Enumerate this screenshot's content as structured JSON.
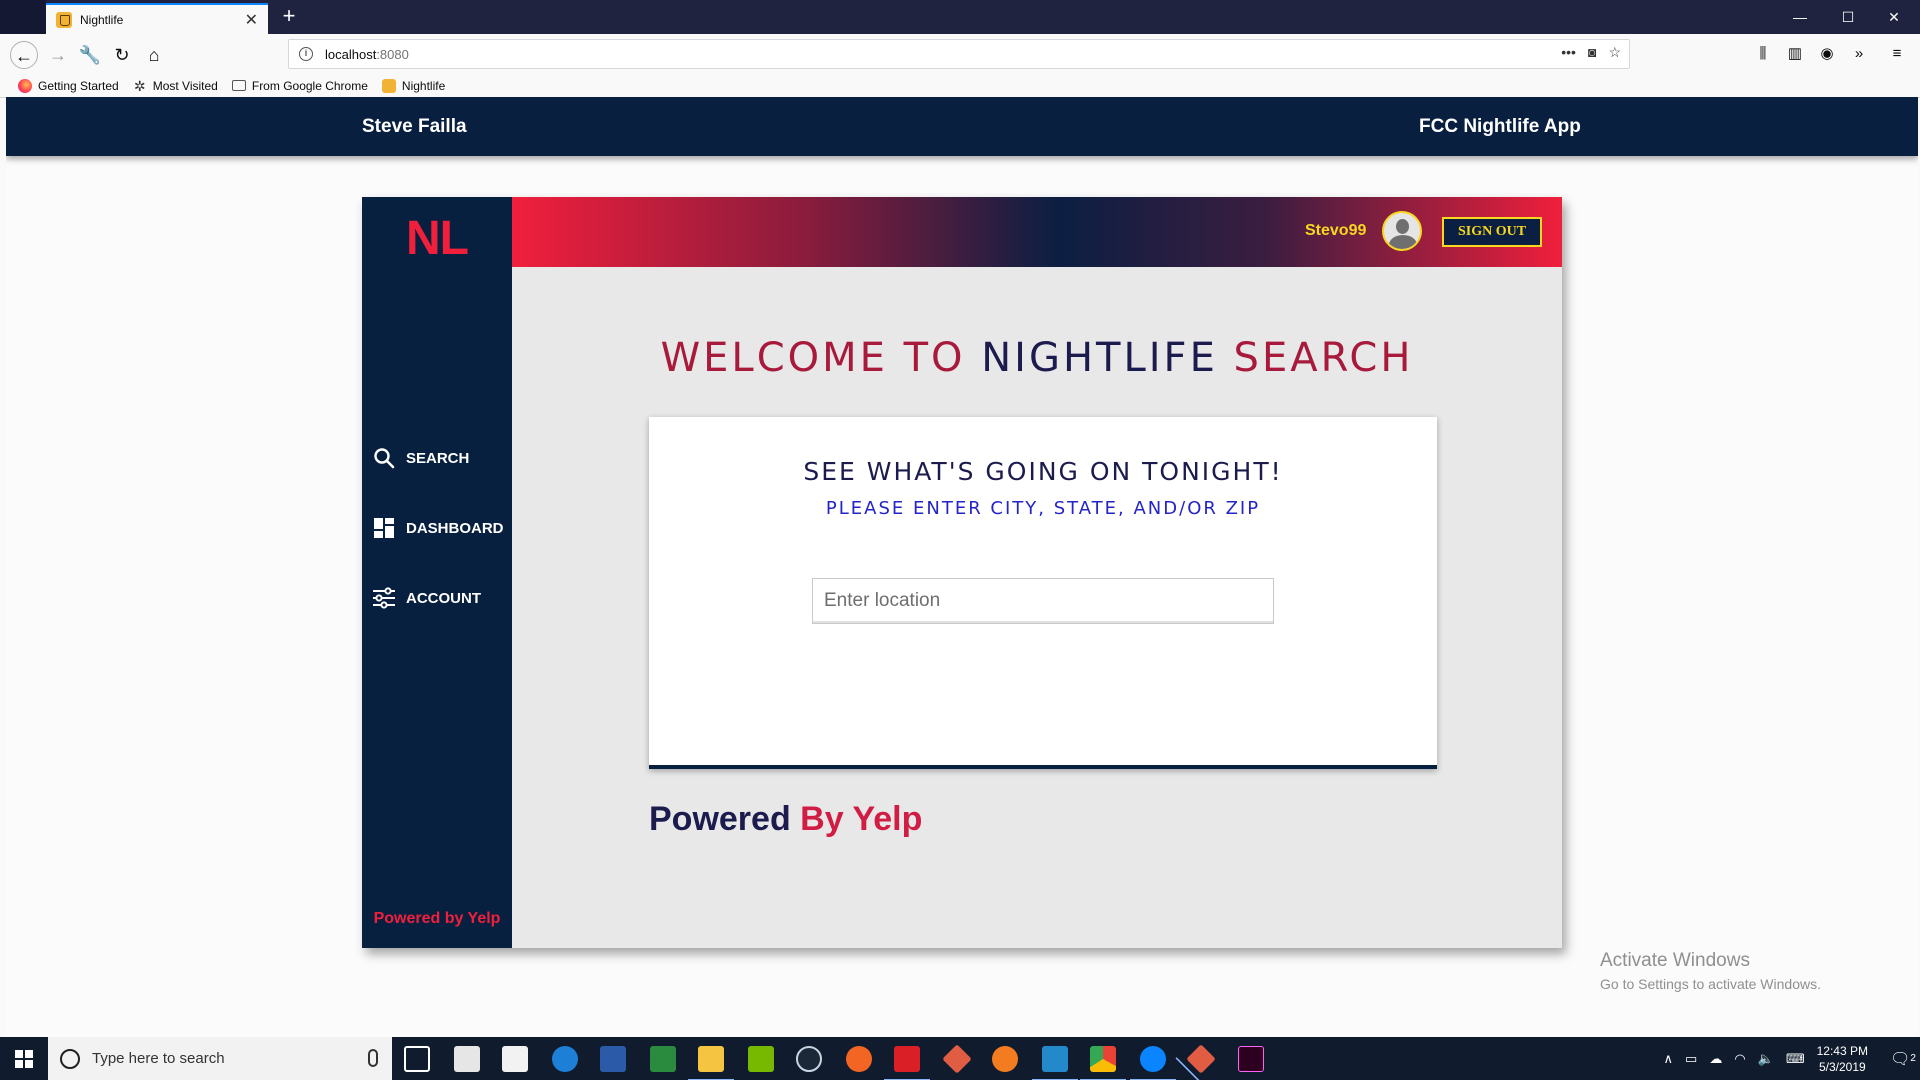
{
  "browser": {
    "tab_title": "Nightlife",
    "url_host": "localhost",
    "url_port": ":8080",
    "bookmarks": [
      "Getting Started",
      "Most Visited",
      "From Google Chrome",
      "Nightlife"
    ]
  },
  "site_header": {
    "owner": "Steve Failla",
    "app_name": "FCC Nightlife App"
  },
  "app": {
    "logo": "NL",
    "sidebar_items": [
      "SEARCH",
      "DASHBOARD",
      "ACCOUNT"
    ],
    "sidebar_footer": "Powered by Yelp",
    "username": "Stevo99",
    "sign_out_label": "SIGN OUT",
    "welcome_part1": "WELCOME TO ",
    "welcome_part2": "NIGHTLIFE",
    "welcome_part3": " SEARCH",
    "card_heading": "SEE WHAT'S GOING ON TONIGHT!",
    "card_subheading": "PLEASE ENTER CITY, STATE, AND/OR ZIP",
    "location_placeholder": "Enter location",
    "location_value": "",
    "powered_part1": "Powered ",
    "powered_part2": "By Yelp"
  },
  "windows": {
    "activate_title": "Activate Windows",
    "activate_sub": "Go to Settings to activate Windows.",
    "search_placeholder": "Type here to search",
    "time": "12:43 PM",
    "date": "5/3/2019",
    "notification_count": "2"
  },
  "colors": {
    "navy": "#08203f",
    "accent_red": "#f01f3c",
    "gold": "#f7d71f"
  }
}
